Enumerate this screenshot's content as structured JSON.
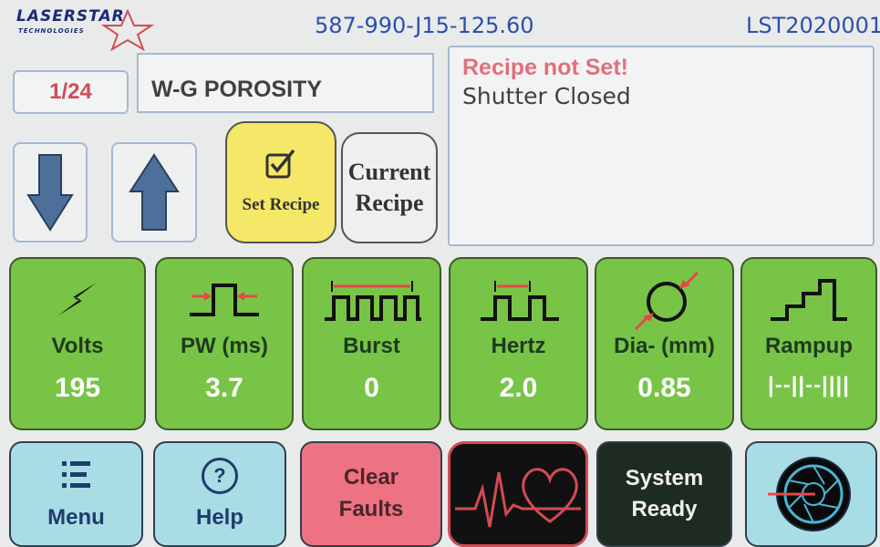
{
  "header": {
    "brand": "LASERSTAR",
    "brand_sub": "TECHNOLOGIES",
    "serial": "587-990-J15-125.60",
    "device_id": "LST2020001"
  },
  "recipe": {
    "number": "1/24",
    "name": "W-G POROSITY",
    "set_recipe_label": "Set Recipe",
    "current_recipe_line1": "Current",
    "current_recipe_line2": "Recipe"
  },
  "status": {
    "warning": "Recipe not Set!",
    "shutter": "Shutter Closed"
  },
  "parameters": [
    {
      "label": "Volts",
      "value": "195",
      "icon": "lightning-icon"
    },
    {
      "label": "PW (ms)",
      "value": "3.7",
      "icon": "pulse-width-icon"
    },
    {
      "label": "Burst",
      "value": "0",
      "icon": "burst-icon"
    },
    {
      "label": "Hertz",
      "value": "2.0",
      "icon": "hertz-icon"
    },
    {
      "label": "Dia- (mm)",
      "value": "0.85",
      "icon": "diameter-icon"
    },
    {
      "label": "Rampup",
      "value": "|--||--||||",
      "icon": "rampup-icon"
    }
  ],
  "bottom": {
    "menu_label": "Menu",
    "help_label": "Help",
    "help_symbol": "?",
    "clear_line1": "Clear",
    "clear_line2": "Faults",
    "system_line1": "System",
    "system_line2": "Ready"
  },
  "colors": {
    "tile_green": "#78c447",
    "set_recipe_yellow": "#f5e868",
    "clear_faults_pink": "#ed7282",
    "nav_blue": "#a9dde6",
    "warning_red": "#e0707d",
    "header_blue": "#2b4fb0"
  }
}
